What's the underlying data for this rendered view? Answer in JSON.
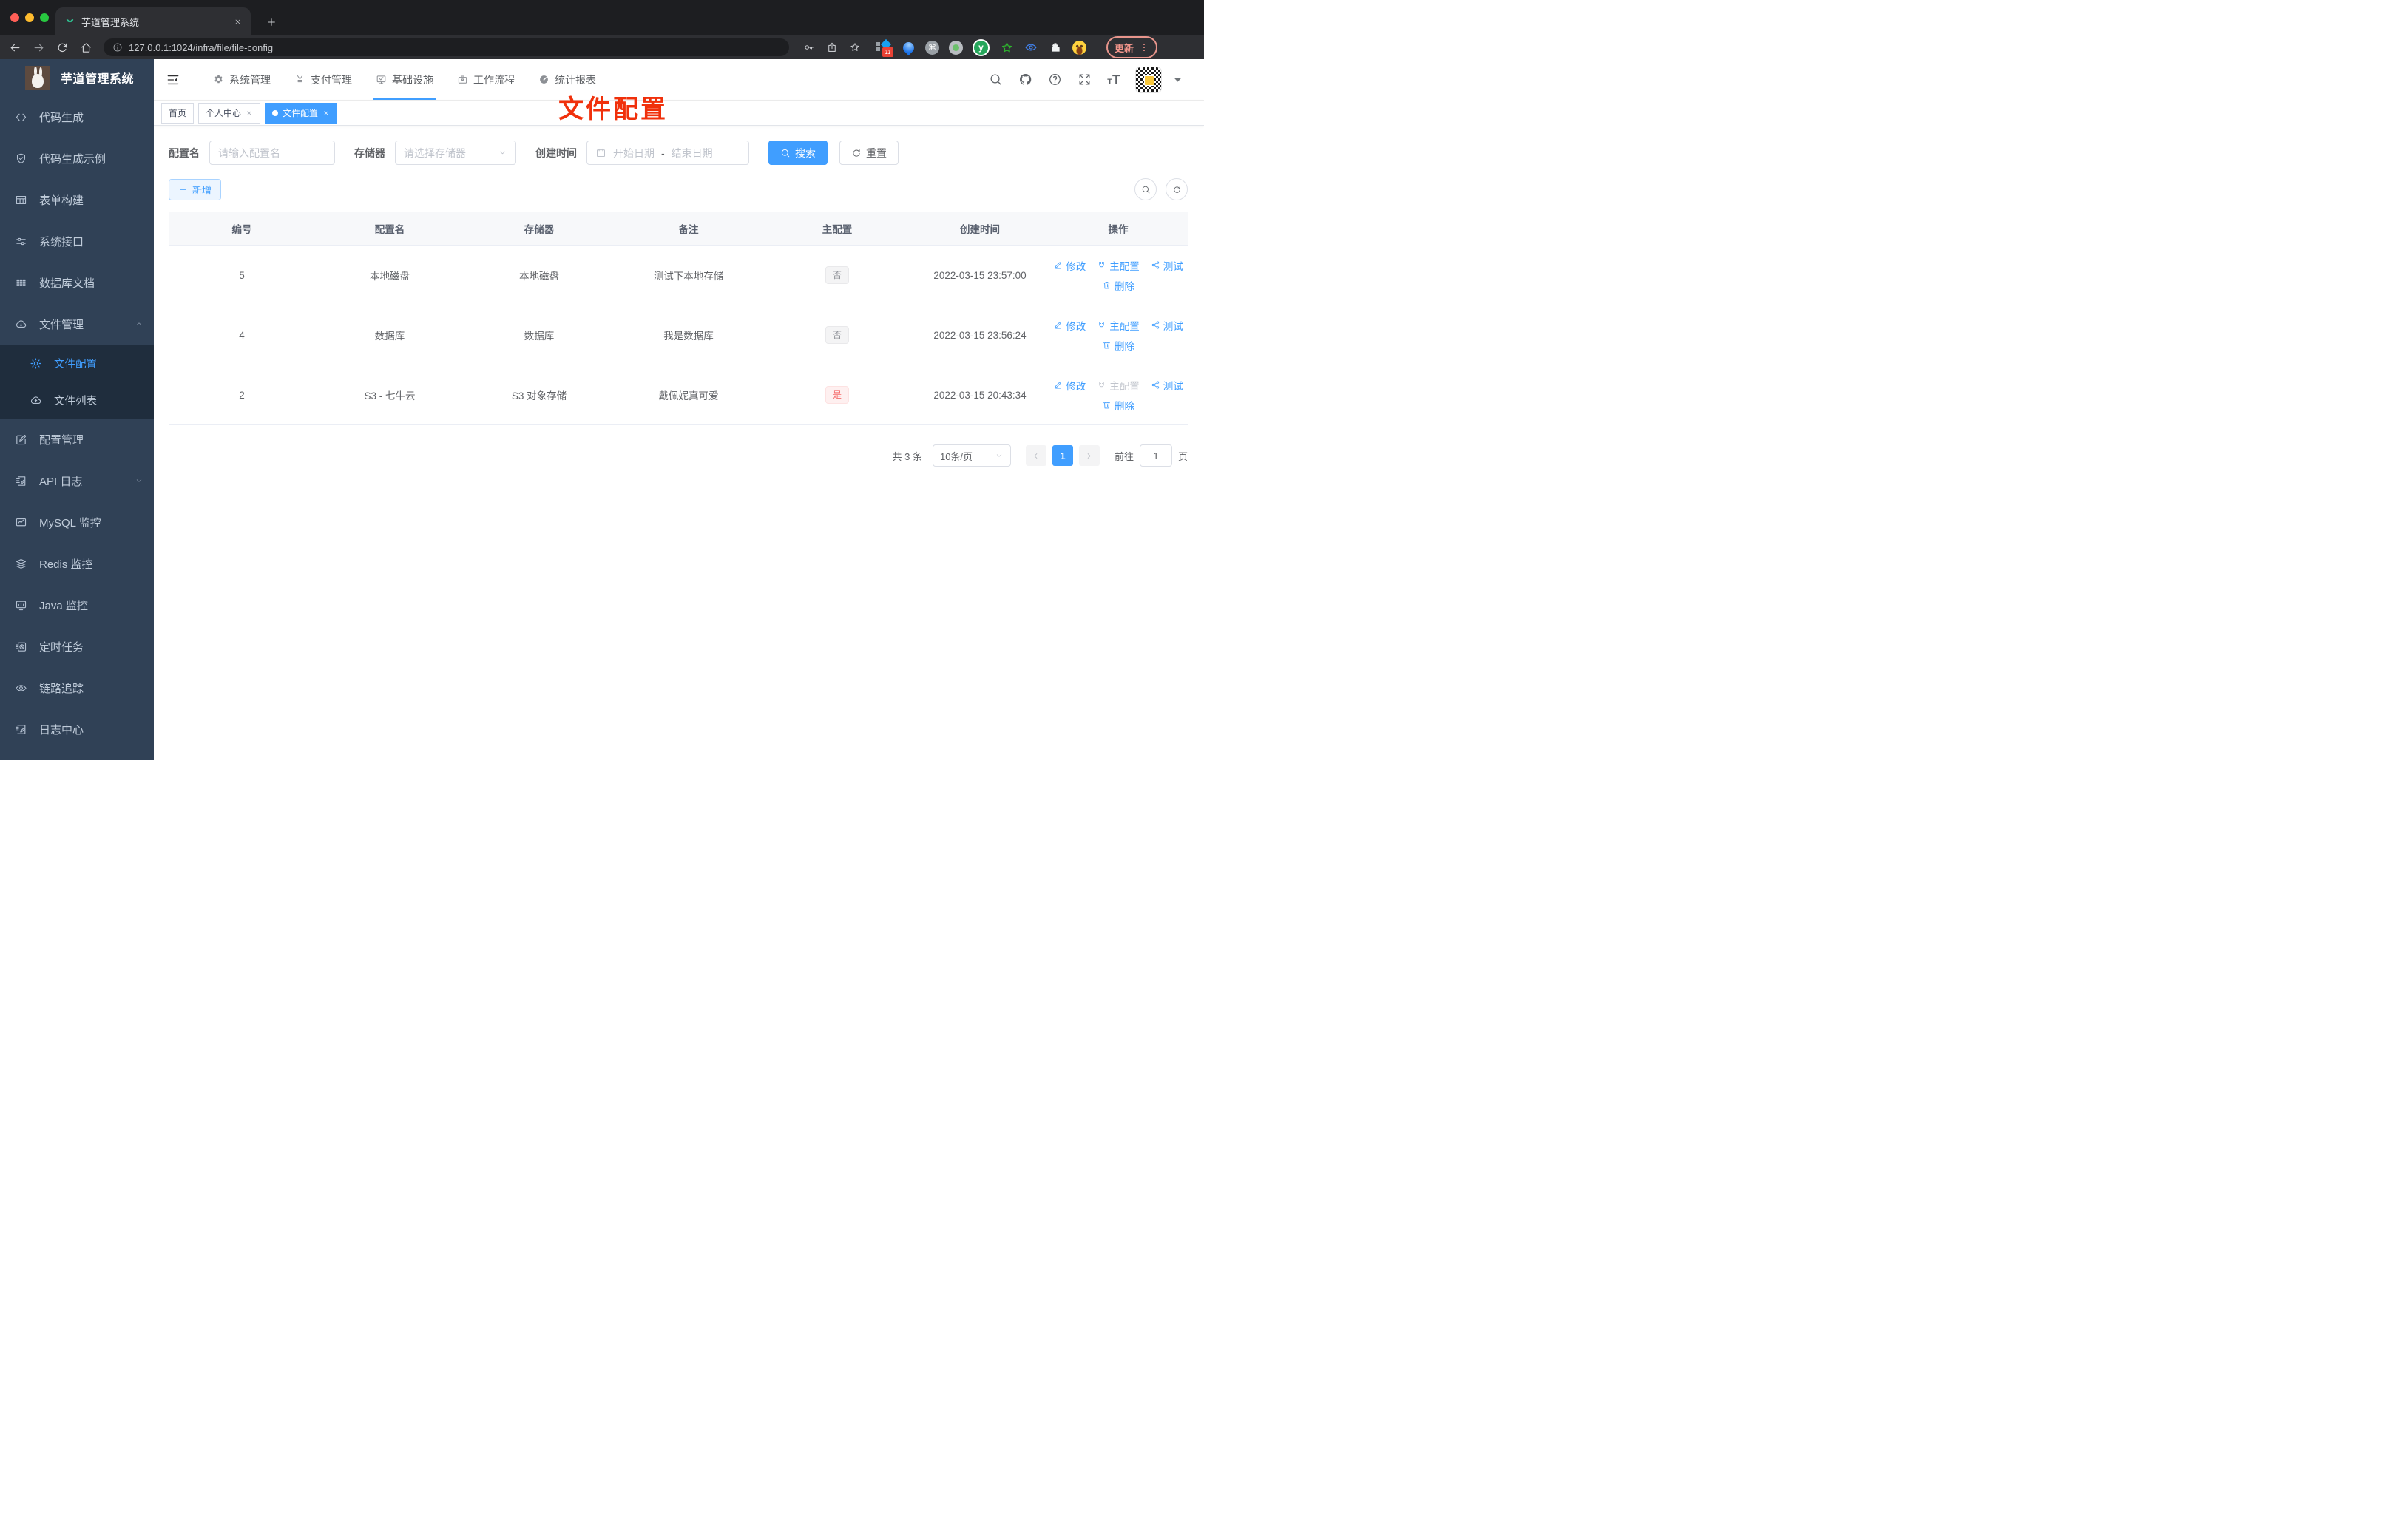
{
  "browser": {
    "tab_title": "芋道管理系统",
    "url": "127.0.0.1:1024/infra/file/file-config",
    "update_label": "更新",
    "extension_badge": "11"
  },
  "sidebar": {
    "app_title": "芋道管理系统",
    "items": [
      {
        "key": "code-gen",
        "icon": "code",
        "label": "代码生成"
      },
      {
        "key": "code-demo",
        "icon": "shield",
        "label": "代码生成示例"
      },
      {
        "key": "form-build",
        "icon": "form",
        "label": "表单构建"
      },
      {
        "key": "system-api",
        "icon": "sliders",
        "label": "系统接口"
      },
      {
        "key": "db-doc",
        "icon": "grid",
        "label": "数据库文档"
      },
      {
        "key": "file-mgmt",
        "icon": "cloud-down",
        "label": "文件管理",
        "expanded": true,
        "children": [
          {
            "key": "file-config",
            "icon": "gear",
            "label": "文件配置",
            "active": true
          },
          {
            "key": "file-list",
            "icon": "cloud-up",
            "label": "文件列表"
          }
        ]
      },
      {
        "key": "config-mgmt",
        "icon": "edit-square",
        "label": "配置管理"
      },
      {
        "key": "api-log",
        "icon": "note",
        "label": "API 日志",
        "collapsed": true
      },
      {
        "key": "mysql-monitor",
        "icon": "chart",
        "label": "MySQL 监控"
      },
      {
        "key": "redis-monitor",
        "icon": "stack",
        "label": "Redis 监控"
      },
      {
        "key": "java-monitor",
        "icon": "monitor",
        "label": "Java 监控"
      },
      {
        "key": "scheduled-job",
        "icon": "timer",
        "label": "定时任务"
      },
      {
        "key": "trace",
        "icon": "eye",
        "label": "链路追踪"
      },
      {
        "key": "log-center",
        "icon": "log",
        "label": "日志中心"
      }
    ]
  },
  "topnav": {
    "menus": [
      {
        "key": "system",
        "icon": "gear-solid",
        "label": "系统管理"
      },
      {
        "key": "payment",
        "icon": "yen",
        "label": "支付管理"
      },
      {
        "key": "infra",
        "icon": "infra",
        "label": "基础设施",
        "active": true
      },
      {
        "key": "workflow",
        "icon": "briefcase",
        "label": "工作流程"
      },
      {
        "key": "report",
        "icon": "dashboard",
        "label": "统计报表"
      }
    ]
  },
  "tags": [
    {
      "label": "首页",
      "closable": false,
      "active": false
    },
    {
      "label": "个人中心",
      "closable": true,
      "active": false
    },
    {
      "label": "文件配置",
      "closable": true,
      "active": true
    }
  ],
  "annotation": {
    "text": "文件配置",
    "color": "#f0300b"
  },
  "filter": {
    "name_label": "配置名",
    "name_placeholder": "请输入配置名",
    "storage_label": "存储器",
    "storage_placeholder": "请选择存储器",
    "date_label": "创建时间",
    "date_start_placeholder": "开始日期",
    "date_separator": "-",
    "date_end_placeholder": "结束日期",
    "search_label": "搜索",
    "reset_label": "重置"
  },
  "toolbar": {
    "add_label": "新增"
  },
  "table": {
    "columns": [
      "编号",
      "配置名",
      "存储器",
      "备注",
      "主配置",
      "创建时间",
      "操作"
    ],
    "action_labels": {
      "edit": "修改",
      "master": "主配置",
      "test": "测试",
      "delete": "删除"
    },
    "rows": [
      {
        "id": "5",
        "name": "本地磁盘",
        "storage": "本地磁盘",
        "remark": "测试下本地存储",
        "master": "否",
        "master_type": "info",
        "created": "2022-03-15 23:57:00",
        "master_action_disabled": false
      },
      {
        "id": "4",
        "name": "数据库",
        "storage": "数据库",
        "remark": "我是数据库",
        "master": "否",
        "master_type": "info",
        "created": "2022-03-15 23:56:24",
        "master_action_disabled": false
      },
      {
        "id": "2",
        "name": "S3 - 七牛云",
        "storage": "S3 对象存储",
        "remark": "戴佩妮真可爱",
        "master": "是",
        "master_type": "danger",
        "created": "2022-03-15 20:43:34",
        "master_action_disabled": true
      }
    ]
  },
  "pagination": {
    "total": "共 3 条",
    "page_size": "10条/页",
    "current_page": "1",
    "goto_label": "前往",
    "goto_value": "1",
    "page_unit": "页"
  },
  "colors": {
    "accent": "#409eff",
    "sidebar_bg": "#304156",
    "submenu_bg": "#1f2d3d",
    "danger": "#f56c6c",
    "annotation_red": "#f0300b"
  }
}
